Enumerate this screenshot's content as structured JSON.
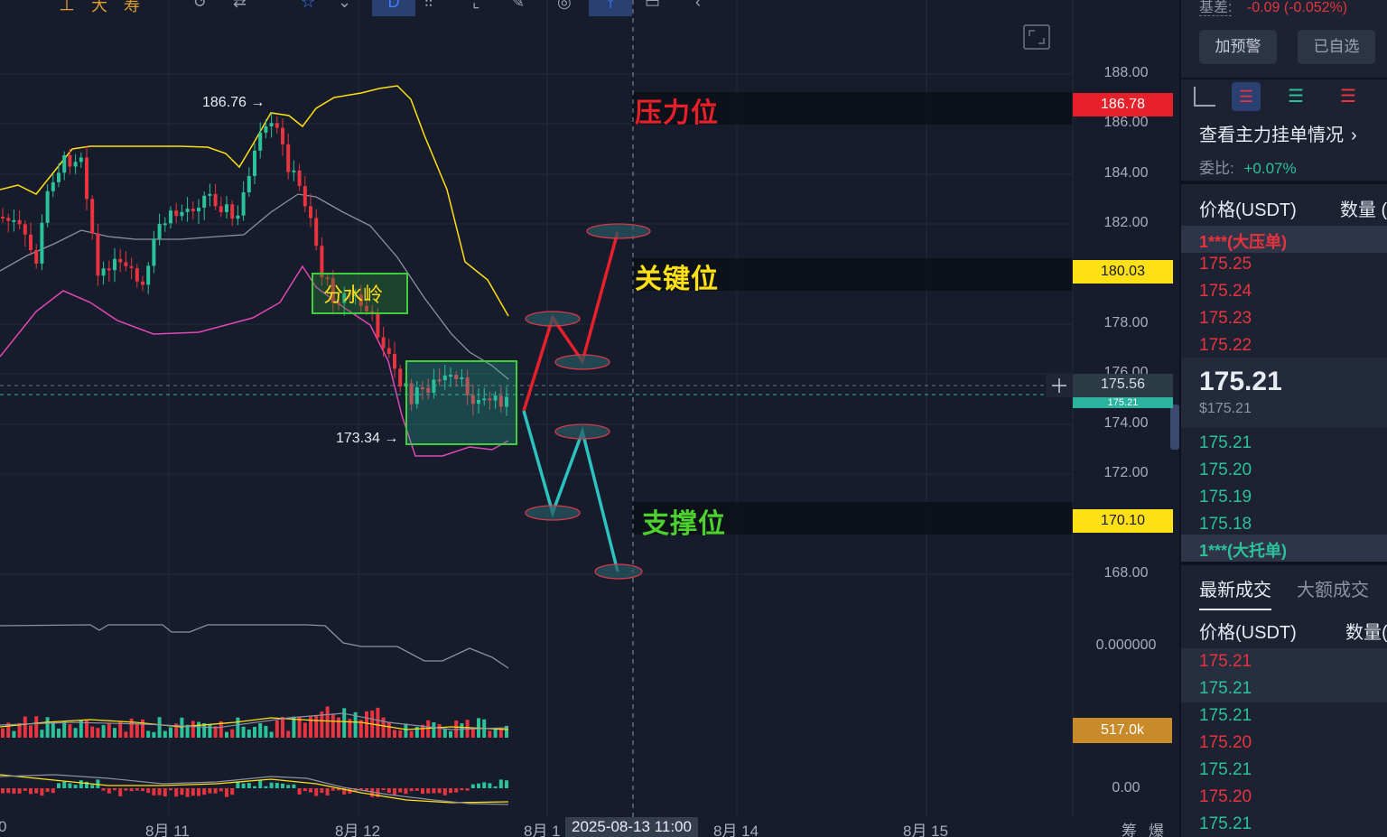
{
  "toolbar": {
    "icons": [
      "timeframe-1d-icon",
      "candles-icon",
      "crop-icon",
      "draw-icon",
      "clock-icon",
      "indicator-icon",
      "layout-icon",
      "arrow-icon"
    ]
  },
  "chart": {
    "price_axis": [
      "188.00",
      "186.00",
      "184.00",
      "182.00",
      "178.00",
      "176.00",
      "174.00",
      "172.00",
      "168.00"
    ],
    "indicator_axis": [
      "0.000000",
      "0.00"
    ],
    "levels": {
      "resistance": {
        "value": "186.78",
        "label": "压力位",
        "color": "#e8202a"
      },
      "key": {
        "value": "180.03",
        "label": "关键位",
        "color": "#ffe014"
      },
      "support": {
        "value": "170.10",
        "label": "支撑位",
        "color": "#ffe014"
      }
    },
    "current_price_tag": "175.56",
    "current_price_tag_sub": "175.21",
    "volume_tag": "517.0k",
    "watershed_label": "分水岭",
    "high_marker": "186.76 →",
    "low_marker": "173.34 →",
    "dates": [
      "0",
      "8月 11",
      "8月 12",
      "8月 1",
      "2025-08-13 11:00",
      "8月 14",
      "8月 15",
      "筹",
      "爆"
    ]
  },
  "sidebar": {
    "basis_label": "基差:",
    "basis_value": "-0.09 (-0.052%)",
    "alert_button": "加预警",
    "watchlist_button": "已自选",
    "order_book_link": "查看主力挂单情况",
    "ratio_label": "委比:",
    "ratio_value": "+0.07%",
    "price_header": "价格(USDT)",
    "qty_header": "数量 (",
    "big_sell_label": "1***(大压单)",
    "asks": [
      "175.25",
      "175.24",
      "175.23",
      "175.22"
    ],
    "last_price": "175.21",
    "last_price_usd": "$175.21",
    "bids": [
      "175.21",
      "175.20",
      "175.19",
      "175.18"
    ],
    "big_buy_label": "1***(大托单)",
    "tab_latest": "最新成交",
    "tab_large": "大额成交",
    "trades_price_header": "价格(USDT)",
    "trades_qty_header": "数量(",
    "trades": [
      {
        "price": "175.21",
        "side": "sell"
      },
      {
        "price": "175.21",
        "side": "buy"
      },
      {
        "price": "175.21",
        "side": "buy"
      },
      {
        "price": "175.20",
        "side": "sell"
      },
      {
        "price": "175.21",
        "side": "buy"
      },
      {
        "price": "175.20",
        "side": "sell"
      },
      {
        "price": "175.21",
        "side": "buy"
      }
    ]
  }
}
